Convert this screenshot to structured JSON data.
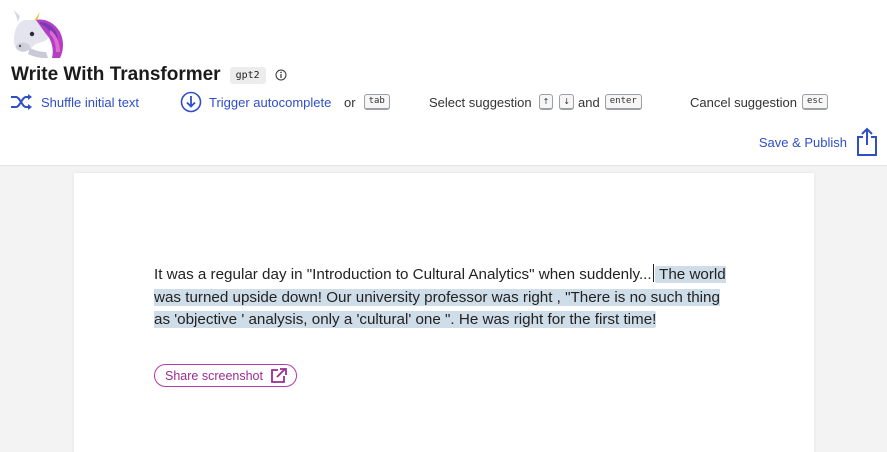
{
  "app": {
    "title": "Write With Transformer",
    "model": "gpt2",
    "logo_icon": "unicorn-icon"
  },
  "toolbar": {
    "shuffle_label": "Shuffle initial text",
    "trigger_label": "Trigger autocomplete",
    "or_text": "or",
    "tab_key": "tab",
    "select_label": "Select suggestion",
    "up_key": "↑",
    "down_key": "↓",
    "and_text": "and",
    "enter_key": "enter",
    "cancel_label": "Cancel suggestion",
    "esc_key": "esc"
  },
  "publish": {
    "label": "Save & Publish"
  },
  "editor": {
    "prompt_text": "It was a regular day in \"Introduction to Cultural Analytics\" when suddenly...",
    "generated_text": " The world was turned upside down!  Our university professor was right , \"There is no such thing as 'objective ' analysis, only a 'cultural' one \". He was right for the first time!"
  },
  "share": {
    "label": "Share screenshot"
  },
  "colors": {
    "accent_link": "#2f4ec8",
    "share_accent": "#9b2c93",
    "highlight": "#cfdde8"
  }
}
